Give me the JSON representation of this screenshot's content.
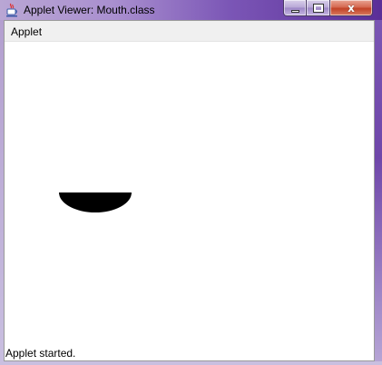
{
  "window": {
    "title": "Applet Viewer: Mouth.class",
    "accent_colors": {
      "titlebar": "#7b56b6",
      "close_button": "#c24328"
    },
    "caption_buttons": {
      "minimize_icon": "minimize-icon",
      "maximize_icon": "maximize-icon",
      "close_icon": "close-icon",
      "close_glyph": "x"
    }
  },
  "menubar": {
    "items": [
      {
        "label": "Applet"
      }
    ]
  },
  "canvas": {
    "shape": "filled black half-ellipse (mouth)",
    "fill_color": "#000000"
  },
  "status": {
    "text": "Applet started."
  }
}
